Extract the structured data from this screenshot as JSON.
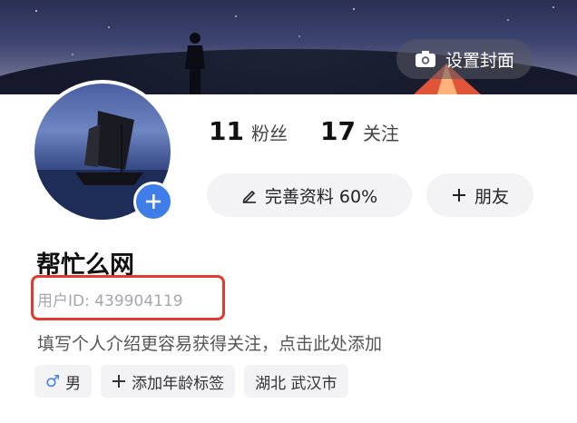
{
  "cover": {
    "set_cover_label": "设置封面",
    "camera_icon": "camera-icon"
  },
  "stats": {
    "fans_count": "11",
    "fans_label": "粉丝",
    "following_count": "17",
    "following_label": "关注"
  },
  "actions": {
    "complete_profile_label": "完善资料 60%",
    "add_friend_label": "朋友"
  },
  "profile": {
    "username": "帮忙么网",
    "user_id": "用户ID: 439904119",
    "bio_placeholder": "填写个人介绍更容易获得关注，点击此处添加"
  },
  "tags": {
    "gender_symbol": "♂",
    "gender": "男",
    "age_label": "添加年龄标签",
    "location": "湖北 武汉市"
  },
  "colors": {
    "accent_blue": "#3f7ee8",
    "highlight_red": "#e23a2e"
  }
}
